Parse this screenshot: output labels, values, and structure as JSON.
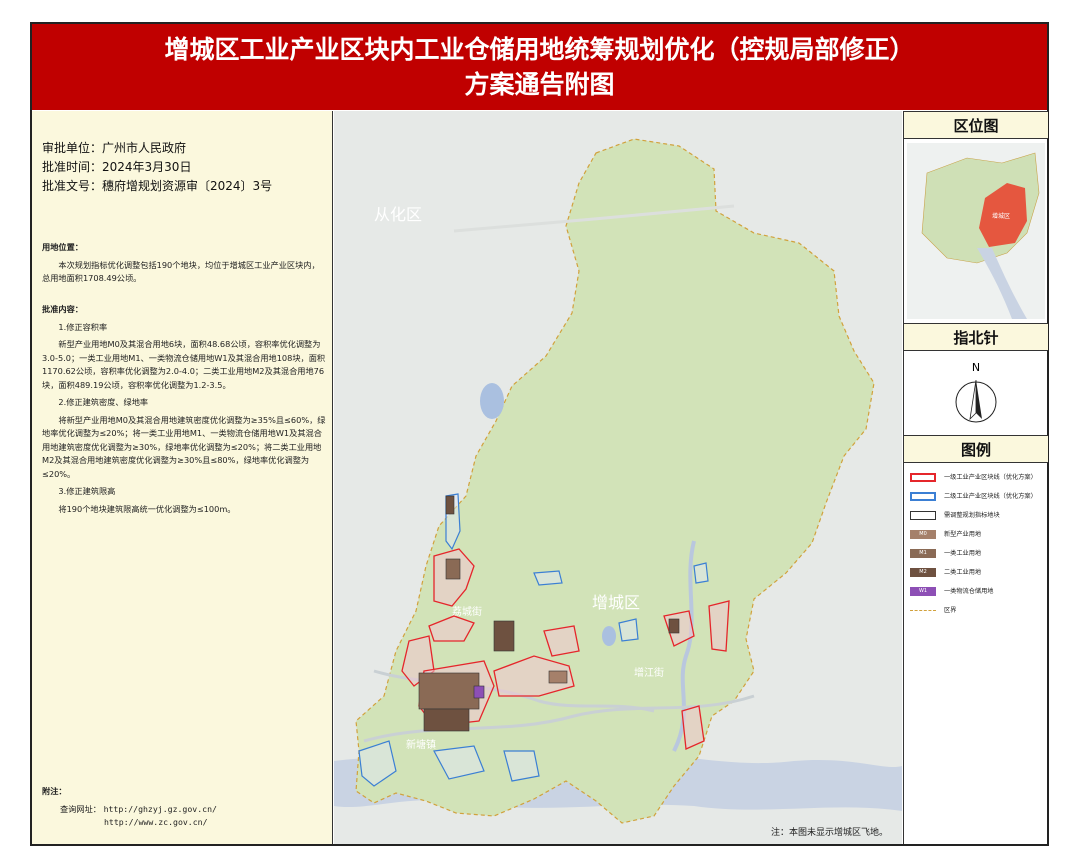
{
  "title": {
    "line1": "增城区工业产业区块内工业仓储用地统筹规划优化（控规局部修正）",
    "line2": "方案通告附图"
  },
  "approval": {
    "unit": "审批单位：广州市人民政府",
    "time": "批准时间：2024年3月30日",
    "doc": "批准文号：穗府增规划资源审〔2024〕3号"
  },
  "land_location": {
    "heading": "用地位置：",
    "text": "本次规划指标优化调整包括190个地块，均位于增城区工业产业区块内，总用地面积1708.49公顷。"
  },
  "approved_content": {
    "heading": "批准内容：",
    "items": [
      {
        "title": "1.修正容积率",
        "text": "新型产业用地M0及其混合用地6块，面积48.68公顷，容积率优化调整为3.0-5.0；一类工业用地M1、一类物流仓储用地W1及其混合用地108块，面积1170.62公顷，容积率优化调整为2.0-4.0；二类工业用地M2及其混合用地76块，面积489.19公顷，容积率优化调整为1.2-3.5。"
      },
      {
        "title": "2.修正建筑密度、绿地率",
        "text": "将新型产业用地M0及其混合用地建筑密度优化调整为≥35%且≤60%，绿地率优化调整为≤20%；将一类工业用地M1、一类物流仓储用地W1及其混合用地建筑密度优化调整为≥30%，绿地率优化调整为≤20%；将二类工业用地M2及其混合用地建筑密度优化调整为≥30%且≤80%，绿地率优化调整为≤20%。"
      },
      {
        "title": "3.修正建筑限高",
        "text": "将190个地块建筑限高统一优化调整为≤100m。"
      }
    ]
  },
  "notes": {
    "heading": "附注：",
    "query_label": "查询网址：",
    "url1": "http://ghzyj.gz.gov.cn/",
    "url2": "http://www.zc.gov.cn/"
  },
  "map": {
    "labels": {
      "conghua": "从化区",
      "zengcheng": "增城区",
      "xintang": "新塘镇",
      "licheng": "荔城街",
      "zengjiang": "增江街"
    },
    "note": "注：本图未显示增城区飞地。"
  },
  "right_panel": {
    "location_map_title": "区位图",
    "location_map_label": "增城区",
    "north_arrow_title": "指北针",
    "north_letter": "N",
    "legend_title": "图例"
  },
  "legend": [
    {
      "code": "",
      "label": "一级工业产业区块线（优化方案）",
      "type": "line",
      "color": "#e5262b"
    },
    {
      "code": "",
      "label": "二级工业产业区块线（优化方案）",
      "type": "line",
      "color": "#3b7fd4"
    },
    {
      "code": "",
      "label": "需调整规划指标地块",
      "type": "outline",
      "color": "#333333"
    },
    {
      "code": "M0",
      "label": "新型产业用地",
      "type": "fill",
      "color": "#a5806a"
    },
    {
      "code": "M1",
      "label": "一类工业用地",
      "type": "fill",
      "color": "#8a6a55"
    },
    {
      "code": "M2",
      "label": "二类工业用地",
      "type": "fill",
      "color": "#6e5140"
    },
    {
      "code": "W1",
      "label": "一类物流仓储用地",
      "type": "fill",
      "color": "#8d4fb5"
    },
    {
      "code": "",
      "label": "区界",
      "type": "dash",
      "color": "#d1a13c"
    }
  ],
  "colors": {
    "title_bg": "#c00000",
    "panel_bg": "#fbf8dd",
    "district_fill": "#d2e3b8",
    "river": "#b9c7de"
  }
}
